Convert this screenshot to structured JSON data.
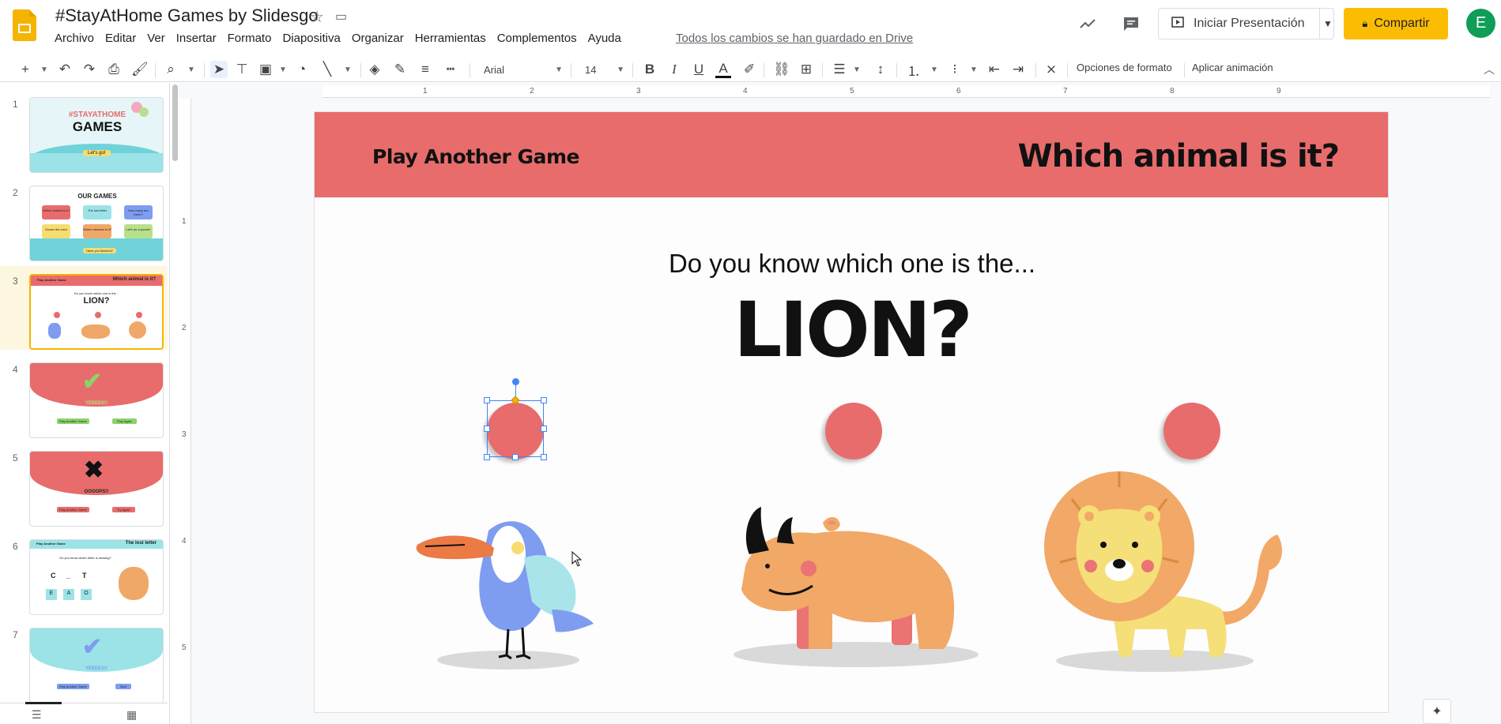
{
  "app": {
    "title": "#StayAtHome Games by Slidesgo",
    "saved_status": "Todos los cambios se han guardado en Drive",
    "menu": [
      "Archivo",
      "Editar",
      "Ver",
      "Insertar",
      "Formato",
      "Diapositiva",
      "Organizar",
      "Herramientas",
      "Complementos",
      "Ayuda"
    ],
    "present_label": "Iniciar Presentación",
    "share_label": "Compartir",
    "avatar_initial": "E",
    "accent_color": "#fbbc04"
  },
  "toolbar": {
    "font": "Arial",
    "font_size": "14",
    "format_options": "Opciones de formato",
    "animate": "Aplicar animación",
    "bold": "B",
    "italic": "I",
    "underline": "U",
    "text_color": "A"
  },
  "ruler": {
    "h": [
      "1",
      "2",
      "3",
      "4",
      "5",
      "6",
      "7",
      "8",
      "9"
    ],
    "v": [
      "1",
      "2",
      "3",
      "4",
      "5"
    ]
  },
  "filmstrip": {
    "view_list_icon": "filmstrip-view-icon",
    "view_grid_icon": "grid-view-icon",
    "slides": [
      {
        "num": "1",
        "title": "#STAYATHOME",
        "subtitle": "GAMES",
        "button": "Let's go!"
      },
      {
        "num": "2",
        "title": "OUR GAMES",
        "games": [
          "Which animal is it?",
          "The lost letter",
          "How many are there?",
          "Guess the color",
          "Where shadow is it?",
          "Let's do a puzzle!"
        ],
        "button": "Have you finished?"
      },
      {
        "num": "3",
        "left": "Play Another Game",
        "right": "Which animal is it?",
        "question": "Do you know which one is the...",
        "big": "LION?"
      },
      {
        "num": "4",
        "word": "YEEEES!!",
        "btn1": "Play Another Game",
        "btn2": "Play Again"
      },
      {
        "num": "5",
        "word": "OOOOPS!!",
        "btn1": "Play Another Game",
        "btn2": "Try Again"
      },
      {
        "num": "6",
        "left": "Play Another Game",
        "right": "The lost letter",
        "question": "Do you know which letter is missing?",
        "letters": [
          "C",
          "_",
          "T"
        ],
        "options": [
          "E",
          "A",
          "O"
        ]
      },
      {
        "num": "7",
        "word": "YEEEES!!",
        "btn1": "Play Another Game",
        "btn2": "Next"
      }
    ]
  },
  "slide": {
    "banner_left": "Play Another Game",
    "banner_right": "Which animal is it?",
    "question": "Do you know which one is the...",
    "answer": "LION?",
    "banner_color": "#e86c6c",
    "choices": [
      "toucan",
      "rhino",
      "lion"
    ]
  }
}
